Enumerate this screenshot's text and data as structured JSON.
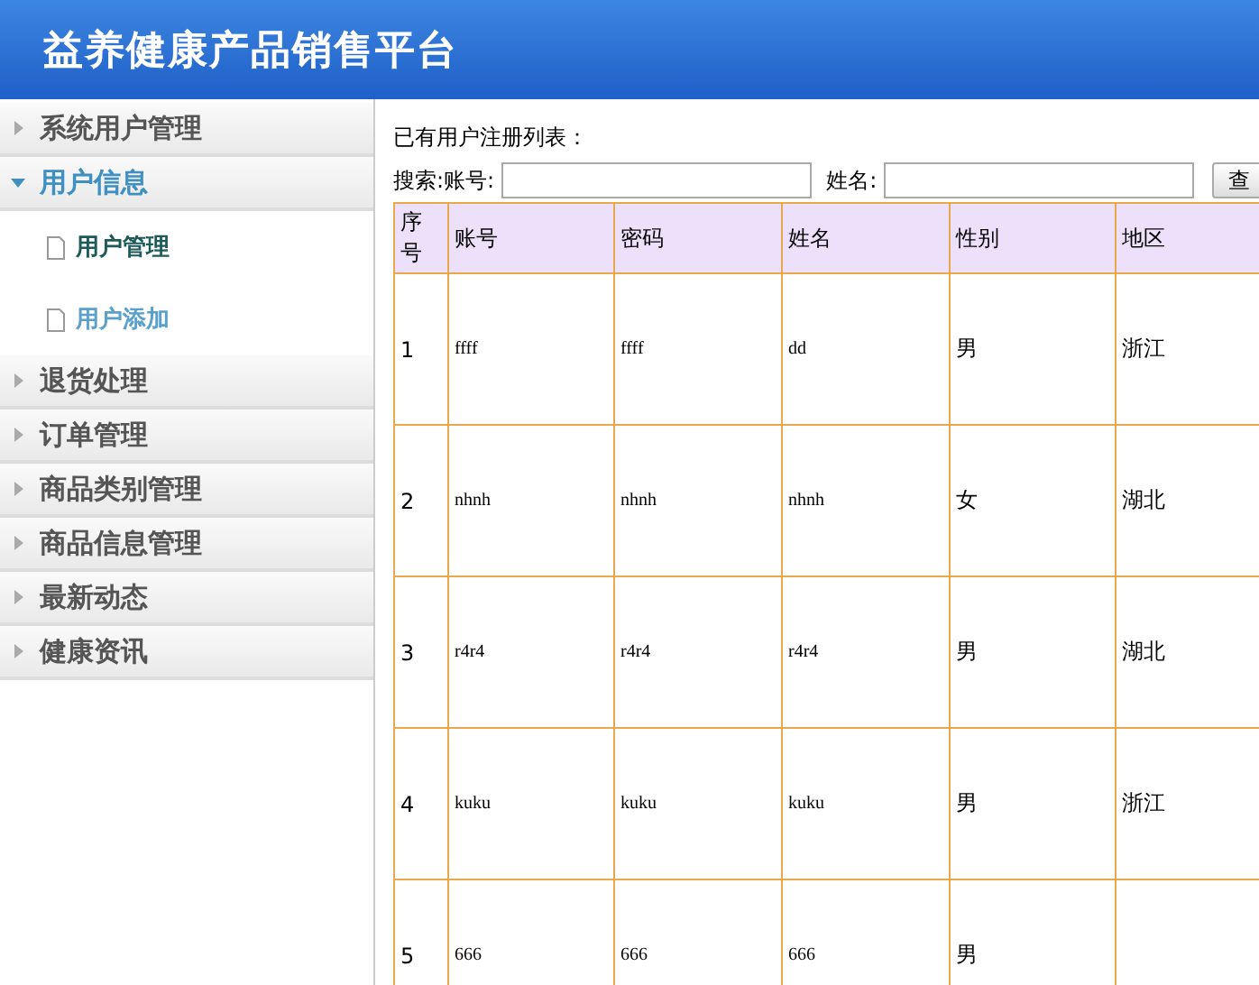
{
  "header": {
    "title": "益养健康产品销售平台"
  },
  "sidebar": {
    "items": [
      {
        "label": "系统用户管理",
        "expanded": false
      },
      {
        "label": "用户信息",
        "expanded": true,
        "children": [
          {
            "label": "用户管理",
            "selected": true
          },
          {
            "label": "用户添加",
            "selected": false
          }
        ]
      },
      {
        "label": "退货处理",
        "expanded": false
      },
      {
        "label": "订单管理",
        "expanded": false
      },
      {
        "label": "商品类别管理",
        "expanded": false
      },
      {
        "label": "商品信息管理",
        "expanded": false
      },
      {
        "label": "最新动态",
        "expanded": false
      },
      {
        "label": "健康资讯",
        "expanded": false
      }
    ]
  },
  "content": {
    "heading": "已有用户注册列表：",
    "search": {
      "fields": [
        {
          "label": "搜索:账号:"
        },
        {
          "label": "姓名:"
        }
      ],
      "button": "查"
    },
    "table": {
      "columns": [
        "序号",
        "账号",
        "密码",
        "姓名",
        "性别",
        "地区"
      ],
      "rows": [
        [
          "1",
          "ffff",
          "ffff",
          "dd",
          "男",
          "浙江"
        ],
        [
          "2",
          "nhnh",
          "nhnh",
          "nhnh",
          "女",
          "湖北"
        ],
        [
          "3",
          "r4r4",
          "r4r4",
          "r4r4",
          "男",
          "湖北"
        ],
        [
          "4",
          "kuku",
          "kuku",
          "kuku",
          "男",
          "浙江"
        ],
        [
          "5",
          "666",
          "666",
          "666",
          "男"
        ]
      ]
    }
  }
}
